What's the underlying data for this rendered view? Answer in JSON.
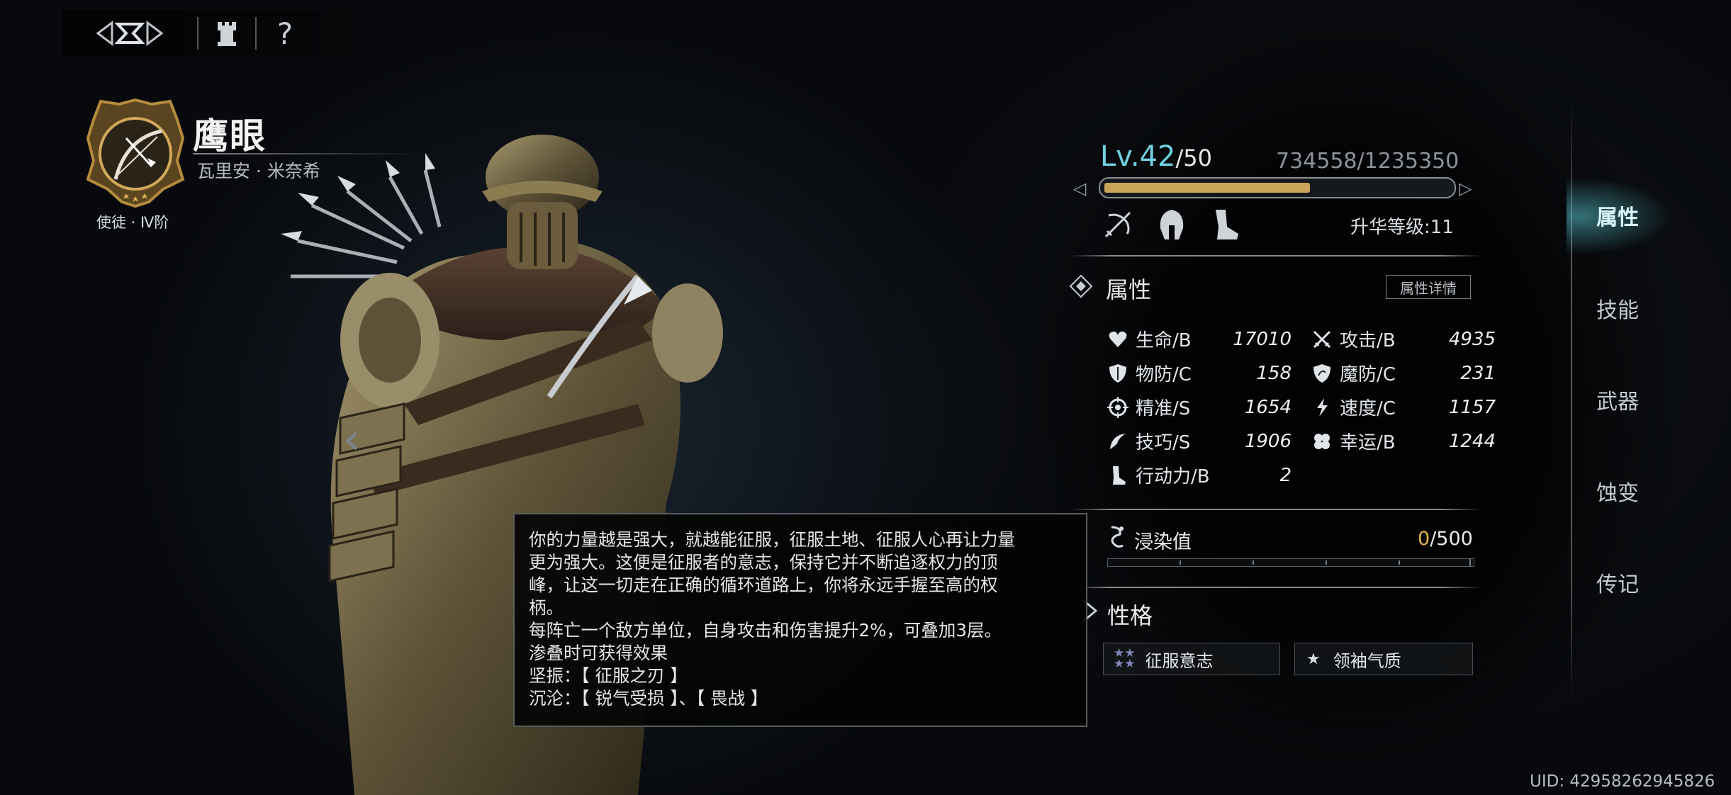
{
  "topbar": {
    "home_icon": "emblem-icon",
    "tower_icon": "tower-icon",
    "help_label": "?"
  },
  "hero": {
    "name": "鹰眼",
    "subtitle": "瓦里安 · 米奈希",
    "rank": "使徒 · Ⅳ阶",
    "crest_icon": "bow-crest-icon"
  },
  "level": {
    "label": "Lv.42",
    "max": "/50",
    "exp": "734558/1235350",
    "exp_fraction": 0.595
  },
  "class_icons": [
    "crossbow-icon",
    "helmet-icon",
    "boot-icon"
  ],
  "ascension": "升华等级:11",
  "attributes": {
    "title": "属性",
    "detail_button": "属性详情",
    "stats": [
      {
        "icon": "heart-icon",
        "label": "生命/B",
        "value": "17010"
      },
      {
        "icon": "swords-icon",
        "label": "攻击/B",
        "value": "4935"
      },
      {
        "icon": "shield-icon",
        "label": "物防/C",
        "value": "158"
      },
      {
        "icon": "magic-shield-icon",
        "label": "魔防/C",
        "value": "231"
      },
      {
        "icon": "crosshair-icon",
        "label": "精准/S",
        "value": "1654"
      },
      {
        "icon": "lightning-icon",
        "label": "速度/C",
        "value": "1157"
      },
      {
        "icon": "skill-icon",
        "label": "技巧/S",
        "value": "1906"
      },
      {
        "icon": "clover-icon",
        "label": "幸运/B",
        "value": "1244"
      },
      {
        "icon": "boot-icon",
        "label": "行动力/B",
        "value": "2"
      }
    ]
  },
  "infection": {
    "label": "浸染值",
    "current": "0",
    "max": "/500",
    "fraction": 0
  },
  "personality": {
    "title": "性格",
    "traits": [
      {
        "icon": "double-star-icon",
        "label": "征服意志"
      },
      {
        "icon": "star-icon",
        "label": "领袖气质"
      }
    ]
  },
  "side_menu": [
    "属性",
    "技能",
    "武器",
    "蚀变",
    "传记"
  ],
  "tooltip": {
    "lines": [
      "你的力量越是强大，就越能征服，征服土地、征服人心再让力量",
      "更为强大。这便是征服者的意志，保持它并不断追逐权力的顶",
      "峰，让这一切走在正确的循环道路上，你将永远手握至高的权",
      "柄。",
      "每阵亡一个敌方单位，自身攻击和伤害提升2%，可叠加3层。",
      "渗叠时可获得效果",
      "坚振：【 征服之刃 】",
      "沉沦：【 锐气受损 】、【 畏战 】"
    ]
  },
  "uid": "UID: 42958262945826",
  "colors": {
    "accent": "#6fd1e0",
    "exp_bar": "#c9a55a",
    "infect_current": "#e2b24a"
  }
}
